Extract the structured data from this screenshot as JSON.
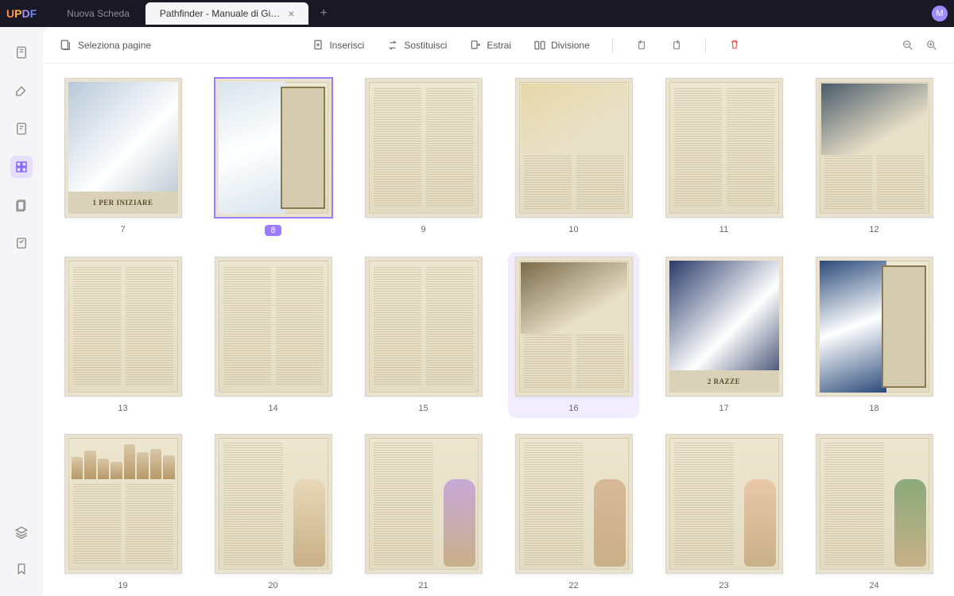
{
  "app": {
    "name": "UPDF",
    "avatar_initial": "M"
  },
  "tabs": [
    {
      "label": "Nuova Scheda",
      "active": false
    },
    {
      "label": "Pathfinder - Manuale di Gi…",
      "active": true
    }
  ],
  "toolbar": {
    "select_pages": "Seleziona pagine",
    "insert": "Inserisci",
    "replace": "Sostituisci",
    "extract": "Estrai",
    "split": "Divisione"
  },
  "pages": [
    {
      "num": "7",
      "kind": "chapter",
      "title": "1 PER INIZIARE",
      "art": "dragon-party",
      "palette": "#b8c8d8"
    },
    {
      "num": "8",
      "kind": "art-text",
      "art": "white-dragon",
      "palette": "#d8e4ec",
      "selected": true
    },
    {
      "num": "9",
      "kind": "text2"
    },
    {
      "num": "10",
      "kind": "half-art",
      "art": "desert-battle",
      "palette": "#e8d8a8"
    },
    {
      "num": "11",
      "kind": "text2"
    },
    {
      "num": "12",
      "kind": "half-art",
      "art": "forest-ambush",
      "palette": "#4a5a6a"
    },
    {
      "num": "13",
      "kind": "text2"
    },
    {
      "num": "14",
      "kind": "table"
    },
    {
      "num": "15",
      "kind": "text2"
    },
    {
      "num": "16",
      "kind": "half-art",
      "art": "dwarf-group",
      "palette": "#7a6a4a",
      "hovered": true
    },
    {
      "num": "17",
      "kind": "chapter",
      "title": "2 RAZZE",
      "art": "blue-hall",
      "palette": "#2a3a6a"
    },
    {
      "num": "18",
      "kind": "art-text",
      "art": "blue-creature",
      "palette": "#2a4a7a"
    },
    {
      "num": "19",
      "kind": "figures",
      "art": "race-lineup",
      "palette": "#d8c8a8"
    },
    {
      "num": "20",
      "kind": "figure-right",
      "art": "male-human",
      "palette": "#e8d8b8"
    },
    {
      "num": "21",
      "kind": "figure-right",
      "art": "gnome-pair",
      "palette": "#c8a8d8"
    },
    {
      "num": "22",
      "kind": "figure-right",
      "art": "halfling",
      "palette": "#d8b898"
    },
    {
      "num": "23",
      "kind": "figure-right",
      "art": "female-elf",
      "palette": "#e8c8a8"
    },
    {
      "num": "24",
      "kind": "figure-right",
      "art": "half-orc",
      "palette": "#8aaa7a"
    }
  ]
}
